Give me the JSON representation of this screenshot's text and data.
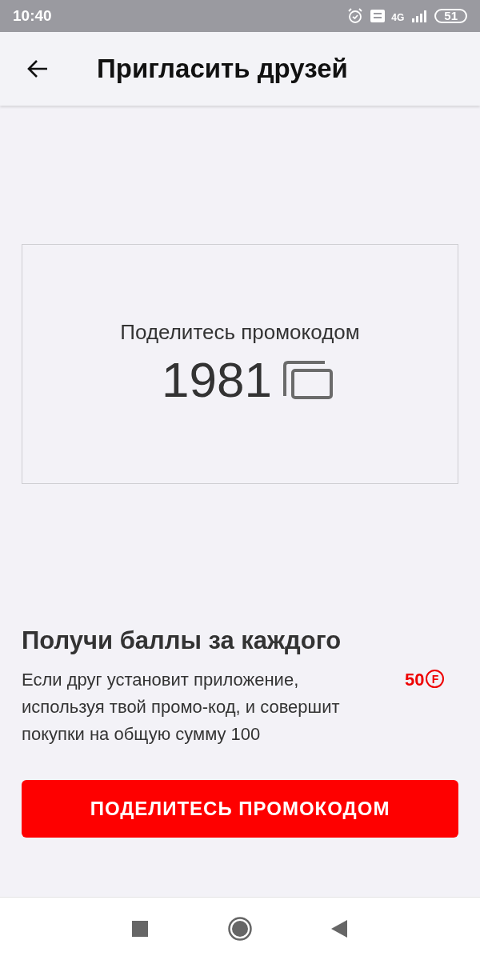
{
  "status_bar": {
    "time": "10:40",
    "network": "4G",
    "battery": "51"
  },
  "header": {
    "title": "Пригласить друзей"
  },
  "promo_card": {
    "caption": "Поделитесь промокодом",
    "code": "1981"
  },
  "reward": {
    "title": "Получи баллы за каждого",
    "description": "Если друг установит приложение, используя твой промо-код, и совершит покупки на общую сумму 100",
    "points": "50",
    "currency_sign": "F"
  },
  "share_button": {
    "label": "ПОДЕЛИТЕСЬ ПРОМОКОДОМ"
  }
}
